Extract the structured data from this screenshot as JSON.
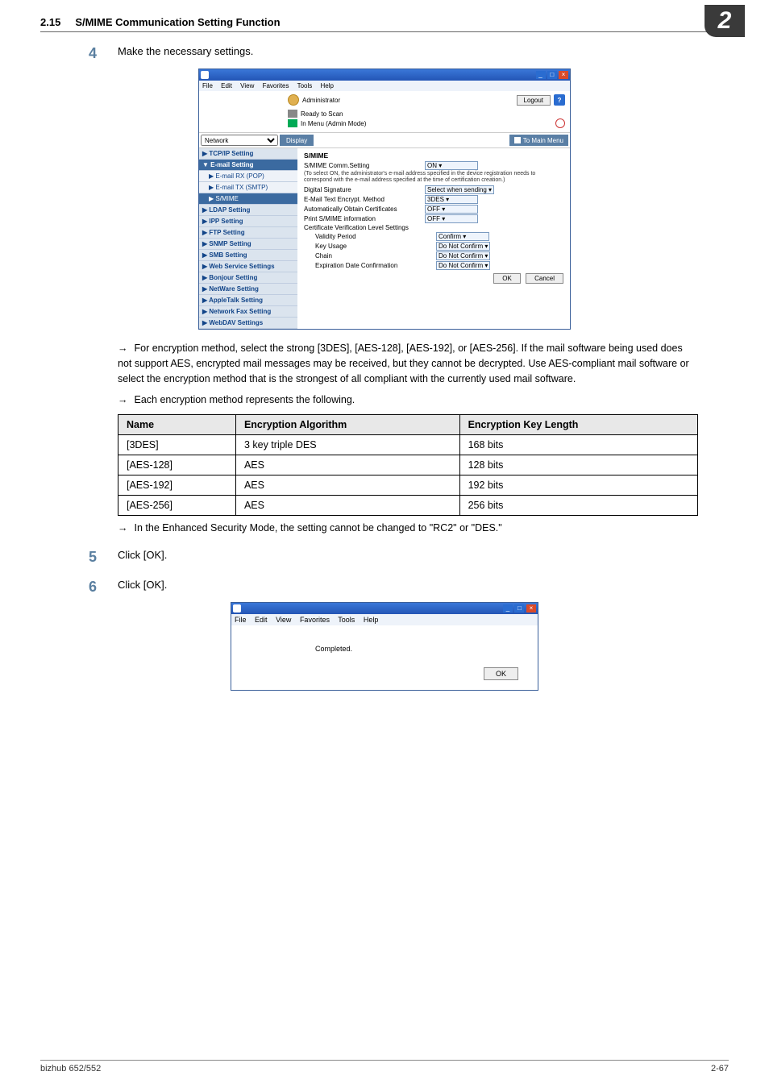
{
  "header": {
    "section_number": "2.15",
    "section_title": "S/MIME Communication Setting Function",
    "chapter_badge": "2"
  },
  "step4": {
    "number": "4",
    "text": "Make the necessary settings."
  },
  "screenshot1": {
    "menubar": {
      "file": "File",
      "edit": "Edit",
      "view": "View",
      "favorites": "Favorites",
      "tools": "Tools",
      "help": "Help"
    },
    "administrator": "Administrator",
    "logout": "Logout",
    "help_icon": "?",
    "status_ready": "Ready to Scan",
    "status_mode": "In Menu (Admin Mode)",
    "nav_dropdown": "Network",
    "display_btn": "Display",
    "to_main_menu": "To Main Menu",
    "sidebar": [
      {
        "label": "TCP/IP Setting",
        "type": "item"
      },
      {
        "label": "E-mail Setting",
        "type": "open"
      },
      {
        "label": "E-mail RX (POP)",
        "type": "sub"
      },
      {
        "label": "E-mail TX (SMTP)",
        "type": "sub"
      },
      {
        "label": "S/MIME",
        "type": "subsel"
      },
      {
        "label": "LDAP Setting",
        "type": "item"
      },
      {
        "label": "IPP Setting",
        "type": "item"
      },
      {
        "label": "FTP Setting",
        "type": "item"
      },
      {
        "label": "SNMP Setting",
        "type": "item"
      },
      {
        "label": "SMB Setting",
        "type": "item"
      },
      {
        "label": "Web Service Settings",
        "type": "item"
      },
      {
        "label": "Bonjour Setting",
        "type": "item"
      },
      {
        "label": "NetWare Setting",
        "type": "item"
      },
      {
        "label": "AppleTalk Setting",
        "type": "item"
      },
      {
        "label": "Network Fax Setting",
        "type": "item"
      },
      {
        "label": "WebDAV Settings",
        "type": "item"
      }
    ],
    "content": {
      "heading": "S/MIME",
      "rows": [
        {
          "label": "S/MIME Comm.Setting",
          "value": "ON"
        },
        {
          "note": "(To select ON, the administrator's e-mail address specified in the device registration needs to correspond with the e-mail address specified at the time of certification creation.)"
        },
        {
          "label": "Digital Signature",
          "value": "Select when sending"
        },
        {
          "label": "E-Mail Text Encrypt. Method",
          "value": "3DES"
        },
        {
          "label": "Automatically Obtain Certificates",
          "value": "OFF"
        },
        {
          "label": "Print S/MIME information",
          "value": "OFF"
        },
        {
          "label": "Certificate Verification Level Settings",
          "value": ""
        },
        {
          "label": "Validity Period",
          "value": "Confirm",
          "indent": true
        },
        {
          "label": "Key Usage",
          "value": "Do Not Confirm",
          "indent": true
        },
        {
          "label": "Chain",
          "value": "Do Not Confirm",
          "indent": true
        },
        {
          "label": "Expiration Date Confirmation",
          "value": "Do Not Confirm",
          "indent": true
        }
      ],
      "ok": "OK",
      "cancel": "Cancel"
    }
  },
  "bullets": {
    "b1": "For encryption method, select the strong [3DES], [AES-128], [AES-192], or [AES-256]. If the mail software being used does not support AES, encrypted mail messages may be received, but they cannot be decrypted. Use AES-compliant mail software or select the encryption method that is the strongest of all compliant with the currently used mail software.",
    "b2": "Each encryption method represents the following.",
    "b3": "In the Enhanced Security Mode, the setting cannot be changed to \"RC2\" or \"DES.\""
  },
  "table": {
    "headers": {
      "name": "Name",
      "alg": "Encryption Algorithm",
      "keylen": "Encryption Key Length"
    },
    "rows": [
      {
        "name": "[3DES]",
        "alg": "3 key triple DES",
        "keylen": "168 bits"
      },
      {
        "name": "[AES-128]",
        "alg": "AES",
        "keylen": "128 bits"
      },
      {
        "name": "[AES-192]",
        "alg": "AES",
        "keylen": "192 bits"
      },
      {
        "name": "[AES-256]",
        "alg": "AES",
        "keylen": "256 bits"
      }
    ]
  },
  "step5": {
    "number": "5",
    "text": "Click [OK]."
  },
  "step6": {
    "number": "6",
    "text": "Click [OK]."
  },
  "screenshot2": {
    "completed": "Completed.",
    "ok": "OK"
  },
  "footer": {
    "model": "bizhub 652/552",
    "page": "2-67"
  }
}
